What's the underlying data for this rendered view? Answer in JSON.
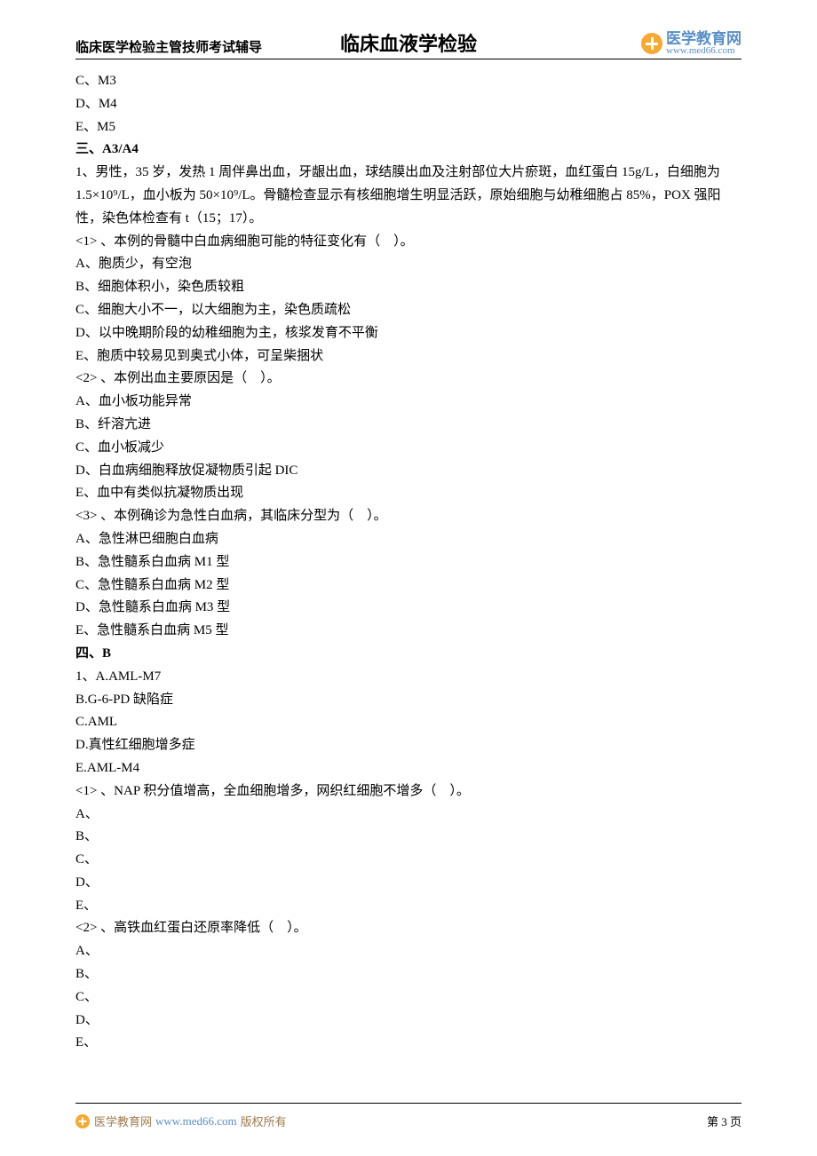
{
  "header": {
    "left": "临床医学检验主管技师考试辅导",
    "center": "临床血液学检验",
    "logo_text_top": "医学教育网",
    "logo_text_bottom": "www.med66.com"
  },
  "content": {
    "c_m3": "C、M3",
    "d_m4": "D、M4",
    "e_m5": "E、M5",
    "section3_title": "三、A3/A4",
    "q1_stem": "1、男性，35 岁，发热 1 周伴鼻出血，牙龈出血，球结膜出血及注射部位大片瘀斑，血红蛋白 15g/L，白细胞为 1.5×10⁹/L，血小板为 50×10⁹/L。骨髓检查显示有核细胞增生明显活跃，原始细胞与幼稚细胞占 85%，POX 强阳性，染色体检查有 t（15；17）。",
    "q1_sub1": "<1> 、本例的骨髓中白血病细胞可能的特征变化有（　）。",
    "q1_sub1_a": "A、胞质少，有空泡",
    "q1_sub1_b": "B、细胞体积小，染色质较粗",
    "q1_sub1_c": "C、细胞大小不一，以大细胞为主，染色质疏松",
    "q1_sub1_d": "D、以中晚期阶段的幼稚细胞为主，核浆发育不平衡",
    "q1_sub1_e": "E、胞质中较易见到奥式小体，可呈柴捆状",
    "q1_sub2": "<2> 、本例出血主要原因是（　）。",
    "q1_sub2_a": "A、血小板功能异常",
    "q1_sub2_b": "B、纤溶亢进",
    "q1_sub2_c": "C、血小板减少",
    "q1_sub2_d": "D、白血病细胞释放促凝物质引起 DIC",
    "q1_sub2_e": "E、血中有类似抗凝物质出现",
    "q1_sub3": "<3> 、本例确诊为急性白血病，其临床分型为（　）。",
    "q1_sub3_a": "A、急性淋巴细胞白血病",
    "q1_sub3_b": "B、急性髓系白血病 M1 型",
    "q1_sub3_c": "C、急性髓系白血病 M2 型",
    "q1_sub3_d": "D、急性髓系白血病 M3 型",
    "q1_sub3_e": "E、急性髓系白血病 M5 型",
    "section4_title": "四、B",
    "b_q1_a": "1、A.AML-M7",
    "b_q1_b": "B.G-6-PD 缺陷症",
    "b_q1_c": "C.AML",
    "b_q1_d": "D.真性红细胞增多症",
    "b_q1_e": "E.AML-M4",
    "b_sub1": "<1> 、NAP 积分值增高，全血细胞增多，网织红细胞不增多（　）。",
    "opt_a": "A、",
    "opt_b": "B、",
    "opt_c": "C、",
    "opt_d": "D、",
    "opt_e": "E、",
    "b_sub2": "<2> 、高铁血红蛋白还原率降低（　）。"
  },
  "footer": {
    "brand": "医学教育网",
    "url": "www.med66.com",
    "copyright": "版权所有",
    "page": "第 3 页"
  }
}
